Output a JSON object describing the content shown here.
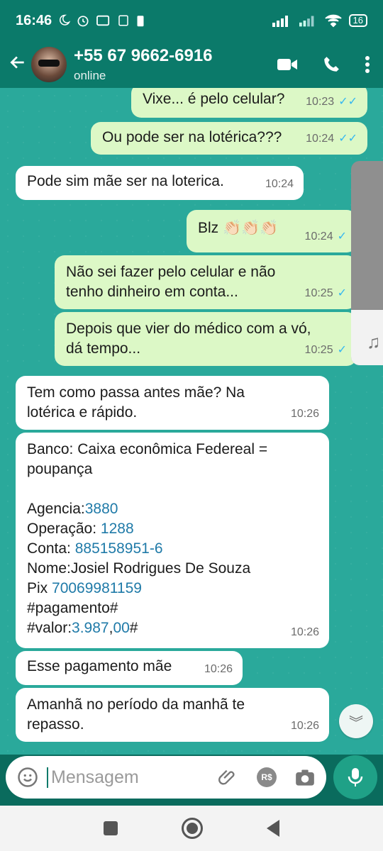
{
  "status": {
    "time": "16:46",
    "battery": "16"
  },
  "header": {
    "contact": "+55 67 9662-6916",
    "presence": "online"
  },
  "messages": [
    {
      "text": "Vixe... é pelo celular?",
      "time": "10:23"
    },
    {
      "text": "Ou pode ser na lotérica???",
      "time": "10:24"
    },
    {
      "text": "Pode sim mãe ser na loterica.",
      "time": "10:24"
    },
    {
      "text": "Blz 👏🏻👏🏻👏🏻",
      "time": "10:24"
    },
    {
      "text": "Não sei fazer pelo celular e não tenho dinheiro em conta...",
      "time": "10:25"
    },
    {
      "text": "Depois que vier do médico com a vó, dá tempo...",
      "time": "10:25"
    },
    {
      "text": "Tem como passa antes mãe? Na lotérica e rápido.",
      "time": "10:26"
    },
    {
      "bank_line1": "Banco: Caixa econômica Federeal =",
      "bank_line2": "poupança",
      "agencia_label": "Agencia:",
      "agencia_value": "3880",
      "operacao_label": "Operação: ",
      "operacao_value": "1288",
      "conta_label": "Conta: ",
      "conta_value": "885158951-6",
      "nome": "Nome:Josiel Rodrigues De Souza",
      "pix_label": "Pix ",
      "pix_value": "70069981159",
      "pagamento": "#pagamento#",
      "valor_label": "#valor:",
      "valor_value": "3.987",
      "valor_sep": ",",
      "valor_cents": "00",
      "valor_end": "#",
      "time": "10:26"
    },
    {
      "text": "Esse pagamento mãe",
      "time": "10:26"
    },
    {
      "text": "Amanhã no período da manhã te repasso.",
      "time": "10:26"
    }
  ],
  "input": {
    "placeholder": "Mensagem"
  },
  "icons": {
    "back": "back-arrow-icon",
    "video": "video-call-icon",
    "call": "phone-icon",
    "menu": "more-vertical-icon",
    "emoji": "emoji-icon",
    "attach": "paperclip-icon",
    "payment": "payment-rs-icon",
    "camera": "camera-icon",
    "mic": "microphone-icon",
    "scroll": "chevron-down-double-icon"
  },
  "colors": {
    "header": "#0b7a6a",
    "chat_bg": "#2aa99b",
    "outgoing": "#dcf8c6",
    "incoming": "#ffffff",
    "link": "#1f7aa8"
  }
}
